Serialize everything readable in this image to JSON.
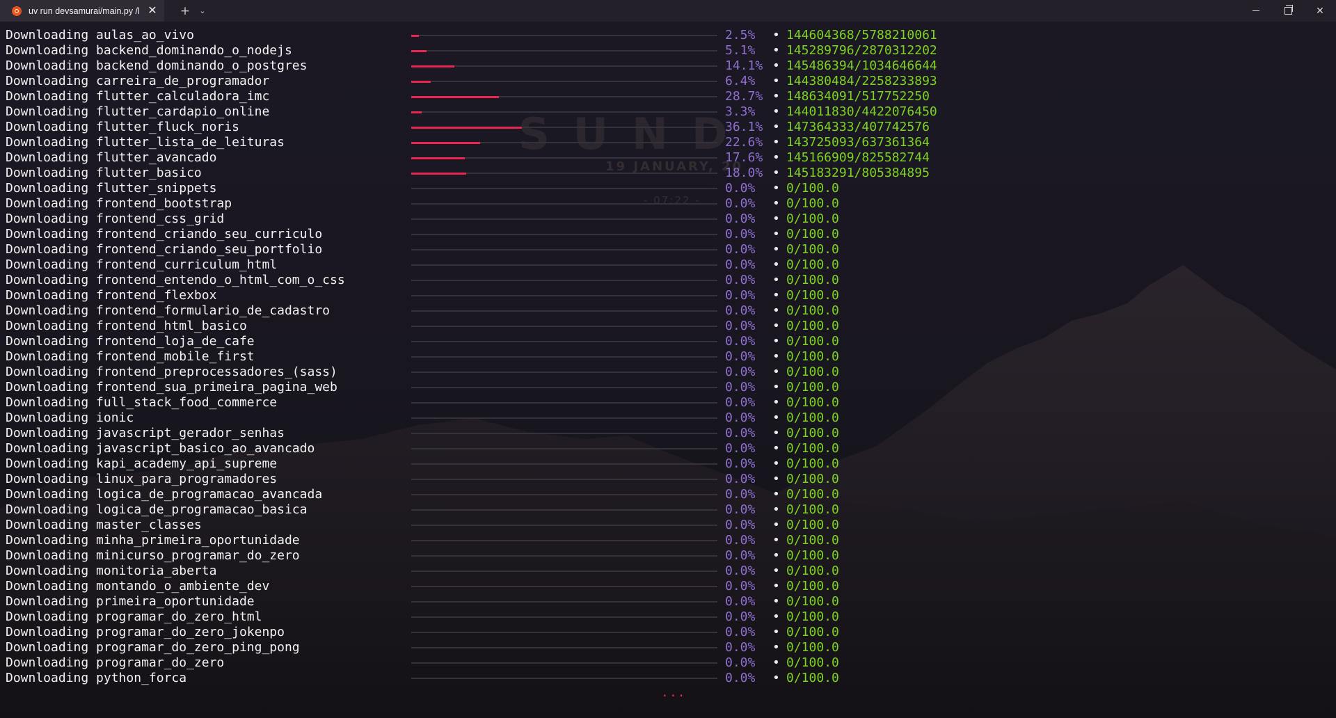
{
  "tab": {
    "title": "uv run devsamurai/main.py /l",
    "close_glyph": "✕"
  },
  "toolbar": {
    "new_tab_glyph": "+",
    "dropdown_glyph": "⌄"
  },
  "window_controls": {
    "close_glyph": "✕"
  },
  "colors": {
    "label": "#f2f2f2",
    "bar_fill": "#e8264f",
    "bar_track": "#34323a",
    "percent": "#8f6fd0",
    "count": "#7ed321",
    "tab_icon": "#e9531c"
  },
  "background": {
    "clock": "SUND",
    "date": "19 JANUARY, 20",
    "time": "- 07:22 -"
  },
  "progress": [
    {
      "label": "Downloading aulas_ao_vivo",
      "fraction": 0.025,
      "percent": "2.5%",
      "dot": "•",
      "count": "144604368/5788210061"
    },
    {
      "label": "Downloading backend_dominando_o_nodejs",
      "fraction": 0.051,
      "percent": "5.1%",
      "dot": "•",
      "count": "145289796/2870312202"
    },
    {
      "label": "Downloading backend_dominando_o_postgres",
      "fraction": 0.141,
      "percent": "14.1%",
      "dot": "•",
      "count": "145486394/1034646644"
    },
    {
      "label": "Downloading carreira_de_programador",
      "fraction": 0.064,
      "percent": "6.4%",
      "dot": "•",
      "count": "144380484/2258233893"
    },
    {
      "label": "Downloading flutter_calculadora_imc",
      "fraction": 0.287,
      "percent": "28.7%",
      "dot": "•",
      "count": "148634091/517752250"
    },
    {
      "label": "Downloading flutter_cardapio_online",
      "fraction": 0.033,
      "percent": "3.3%",
      "dot": "•",
      "count": "144011830/4422076450"
    },
    {
      "label": "Downloading flutter_fluck_noris",
      "fraction": 0.361,
      "percent": "36.1%",
      "dot": "•",
      "count": "147364333/407742576"
    },
    {
      "label": "Downloading flutter_lista_de_leituras",
      "fraction": 0.226,
      "percent": "22.6%",
      "dot": "•",
      "count": "143725093/637361364"
    },
    {
      "label": "Downloading flutter_avancado",
      "fraction": 0.176,
      "percent": "17.6%",
      "dot": "•",
      "count": "145166909/825582744"
    },
    {
      "label": "Downloading flutter_basico",
      "fraction": 0.18,
      "percent": "18.0%",
      "dot": "•",
      "count": "145183291/805384895"
    },
    {
      "label": "Downloading flutter_snippets",
      "fraction": 0,
      "percent": "0.0%",
      "dot": "•",
      "count": "0/100.0"
    },
    {
      "label": "Downloading frontend_bootstrap",
      "fraction": 0,
      "percent": "0.0%",
      "dot": "•",
      "count": "0/100.0"
    },
    {
      "label": "Downloading frontend_css_grid",
      "fraction": 0,
      "percent": "0.0%",
      "dot": "•",
      "count": "0/100.0"
    },
    {
      "label": "Downloading frontend_criando_seu_curriculo",
      "fraction": 0,
      "percent": "0.0%",
      "dot": "•",
      "count": "0/100.0"
    },
    {
      "label": "Downloading frontend_criando_seu_portfolio",
      "fraction": 0,
      "percent": "0.0%",
      "dot": "•",
      "count": "0/100.0"
    },
    {
      "label": "Downloading frontend_curriculum_html",
      "fraction": 0,
      "percent": "0.0%",
      "dot": "•",
      "count": "0/100.0"
    },
    {
      "label": "Downloading frontend_entendo_o_html_com_o_css",
      "fraction": 0,
      "percent": "0.0%",
      "dot": "•",
      "count": "0/100.0"
    },
    {
      "label": "Downloading frontend_flexbox",
      "fraction": 0,
      "percent": "0.0%",
      "dot": "•",
      "count": "0/100.0"
    },
    {
      "label": "Downloading frontend_formulario_de_cadastro",
      "fraction": 0,
      "percent": "0.0%",
      "dot": "•",
      "count": "0/100.0"
    },
    {
      "label": "Downloading frontend_html_basico",
      "fraction": 0,
      "percent": "0.0%",
      "dot": "•",
      "count": "0/100.0"
    },
    {
      "label": "Downloading frontend_loja_de_cafe",
      "fraction": 0,
      "percent": "0.0%",
      "dot": "•",
      "count": "0/100.0"
    },
    {
      "label": "Downloading frontend_mobile_first",
      "fraction": 0,
      "percent": "0.0%",
      "dot": "•",
      "count": "0/100.0"
    },
    {
      "label": "Downloading frontend_preprocessadores_(sass)",
      "fraction": 0,
      "percent": "0.0%",
      "dot": "•",
      "count": "0/100.0"
    },
    {
      "label": "Downloading frontend_sua_primeira_pagina_web",
      "fraction": 0,
      "percent": "0.0%",
      "dot": "•",
      "count": "0/100.0"
    },
    {
      "label": "Downloading full_stack_food_commerce",
      "fraction": 0,
      "percent": "0.0%",
      "dot": "•",
      "count": "0/100.0"
    },
    {
      "label": "Downloading ionic",
      "fraction": 0,
      "percent": "0.0%",
      "dot": "•",
      "count": "0/100.0"
    },
    {
      "label": "Downloading javascript_gerador_senhas",
      "fraction": 0,
      "percent": "0.0%",
      "dot": "•",
      "count": "0/100.0"
    },
    {
      "label": "Downloading javascript_basico_ao_avancado",
      "fraction": 0,
      "percent": "0.0%",
      "dot": "•",
      "count": "0/100.0"
    },
    {
      "label": "Downloading kapi_academy_api_supreme",
      "fraction": 0,
      "percent": "0.0%",
      "dot": "•",
      "count": "0/100.0"
    },
    {
      "label": "Downloading linux_para_programadores",
      "fraction": 0,
      "percent": "0.0%",
      "dot": "•",
      "count": "0/100.0"
    },
    {
      "label": "Downloading logica_de_programacao_avancada",
      "fraction": 0,
      "percent": "0.0%",
      "dot": "•",
      "count": "0/100.0"
    },
    {
      "label": "Downloading logica_de_programacao_basica",
      "fraction": 0,
      "percent": "0.0%",
      "dot": "•",
      "count": "0/100.0"
    },
    {
      "label": "Downloading master_classes",
      "fraction": 0,
      "percent": "0.0%",
      "dot": "•",
      "count": "0/100.0"
    },
    {
      "label": "Downloading minha_primeira_oportunidade",
      "fraction": 0,
      "percent": "0.0%",
      "dot": "•",
      "count": "0/100.0"
    },
    {
      "label": "Downloading minicurso_programar_do_zero",
      "fraction": 0,
      "percent": "0.0%",
      "dot": "•",
      "count": "0/100.0"
    },
    {
      "label": "Downloading monitoria_aberta",
      "fraction": 0,
      "percent": "0.0%",
      "dot": "•",
      "count": "0/100.0"
    },
    {
      "label": "Downloading montando_o_ambiente_dev",
      "fraction": 0,
      "percent": "0.0%",
      "dot": "•",
      "count": "0/100.0"
    },
    {
      "label": "Downloading primeira_oportunidade",
      "fraction": 0,
      "percent": "0.0%",
      "dot": "•",
      "count": "0/100.0"
    },
    {
      "label": "Downloading programar_do_zero_html",
      "fraction": 0,
      "percent": "0.0%",
      "dot": "•",
      "count": "0/100.0"
    },
    {
      "label": "Downloading programar_do_zero_jokenpo",
      "fraction": 0,
      "percent": "0.0%",
      "dot": "•",
      "count": "0/100.0"
    },
    {
      "label": "Downloading programar_do_zero_ping_pong",
      "fraction": 0,
      "percent": "0.0%",
      "dot": "•",
      "count": "0/100.0"
    },
    {
      "label": "Downloading programar_do_zero",
      "fraction": 0,
      "percent": "0.0%",
      "dot": "•",
      "count": "0/100.0"
    },
    {
      "label": "Downloading python_forca",
      "fraction": 0,
      "percent": "0.0%",
      "dot": "•",
      "count": "0/100.0"
    }
  ],
  "more_indicator": "..."
}
